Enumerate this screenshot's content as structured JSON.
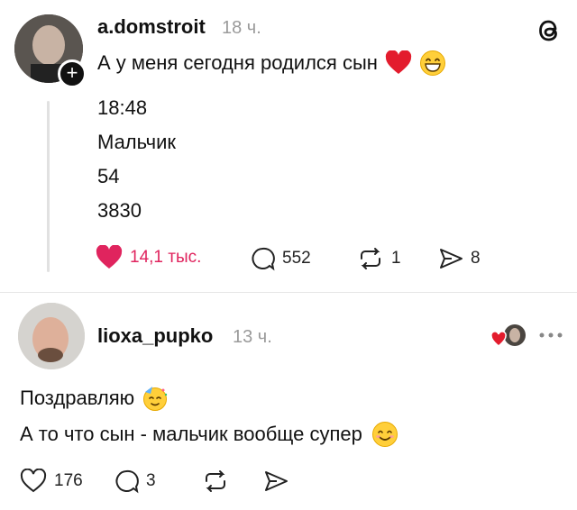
{
  "post": {
    "username": "a.domstroit",
    "time": "18 ч.",
    "text": "А у меня сегодня родился сын",
    "lines": [
      "18:48",
      "Мальчик",
      "54",
      "3830"
    ],
    "actions": {
      "likes": "14,1 тыс.",
      "comments": "552",
      "reposts": "1",
      "shares": "8"
    }
  },
  "reply": {
    "username": "lioxa_pupko",
    "time": "13 ч.",
    "line1": "Поздравляю",
    "line2": "А то что сын - мальчик вообще супер",
    "actions": {
      "likes": "176",
      "comments": "3"
    }
  },
  "colors": {
    "like_red": "#e0245e",
    "muted": "#9a9a9a"
  },
  "icons": [
    "threads-logo-icon",
    "heart-icon",
    "comment-icon",
    "repost-icon",
    "share-icon",
    "more-icon",
    "plus-icon"
  ]
}
